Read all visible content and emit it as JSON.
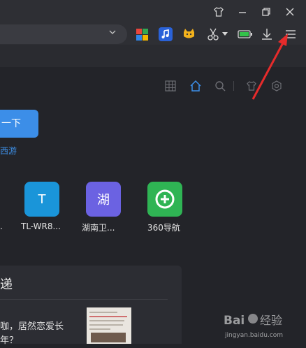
{
  "page": {
    "search_button_label": "一下",
    "hot_link": "西游",
    "section_title": "递",
    "news_line1": "咖，居然恋爱长",
    "news_line2": "年？"
  },
  "sites": [
    {
      "icon_text": "T",
      "label": "TL-WR8...",
      "color": "#1a95d9"
    },
    {
      "icon_text": "湖",
      "label": "湖南卫...",
      "color": "#6b62e2"
    },
    {
      "icon_text": "",
      "label": "360导航",
      "color": "#2fb454"
    }
  ],
  "truncated_label": ".",
  "watermark": {
    "text": "Baidu 经验",
    "url": "jingyan.baidu.com"
  },
  "colors": {
    "accent": "#3c8ee8",
    "annotation": "#e62b2b"
  }
}
